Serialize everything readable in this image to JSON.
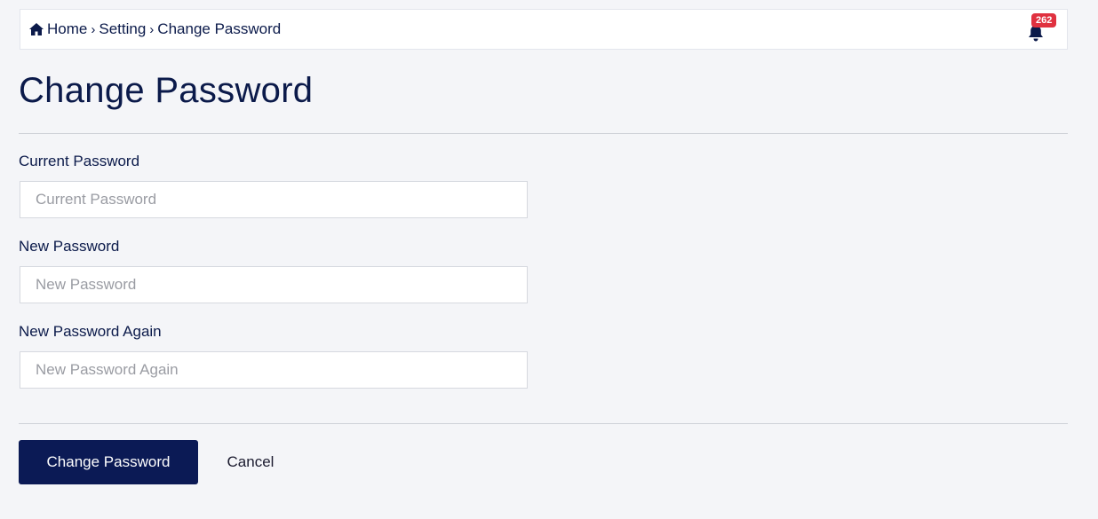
{
  "breadcrumb": {
    "items": [
      "Home",
      "Setting",
      "Change Password"
    ],
    "home_icon": "home-icon",
    "separator_icon": "chevron-right-icon"
  },
  "notifications": {
    "icon": "bell-icon",
    "count": "262",
    "badge_color": "#e0313f"
  },
  "page": {
    "title": "Change Password"
  },
  "form": {
    "current": {
      "label": "Current Password",
      "placeholder": "Current Password",
      "value": ""
    },
    "new": {
      "label": "New Password",
      "placeholder": "New Password",
      "value": ""
    },
    "again": {
      "label": "New Password Again",
      "placeholder": "New Password Again",
      "value": ""
    }
  },
  "actions": {
    "submit_label": "Change Password",
    "cancel_label": "Cancel",
    "primary_color": "#0b1a55"
  }
}
